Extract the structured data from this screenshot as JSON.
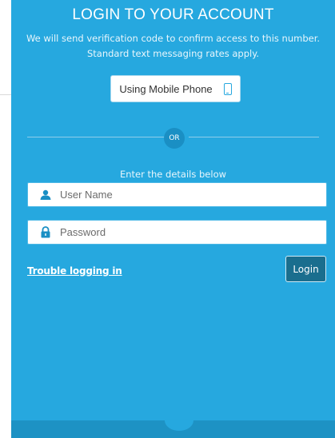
{
  "login": {
    "title": "LOGIN TO YOUR ACCOUNT",
    "subtitle_line1": "We will send verification code to confirm access to this number.",
    "subtitle_line2": "Standard text messaging rates apply.",
    "mobile_button_label": "Using Mobile Phone",
    "or_label": "OR",
    "details_label": "Enter the details below",
    "username_placeholder": "User Name",
    "password_placeholder": "Password",
    "trouble_link": "Trouble logging in",
    "login_button": "Login"
  },
  "icons": {
    "phone": "mobile-phone-icon",
    "user": "user-icon",
    "lock": "lock-icon"
  },
  "colors": {
    "panel": "#26a8df",
    "login_button": "#1a6e8e",
    "or_circle": "#1a8fc4"
  }
}
